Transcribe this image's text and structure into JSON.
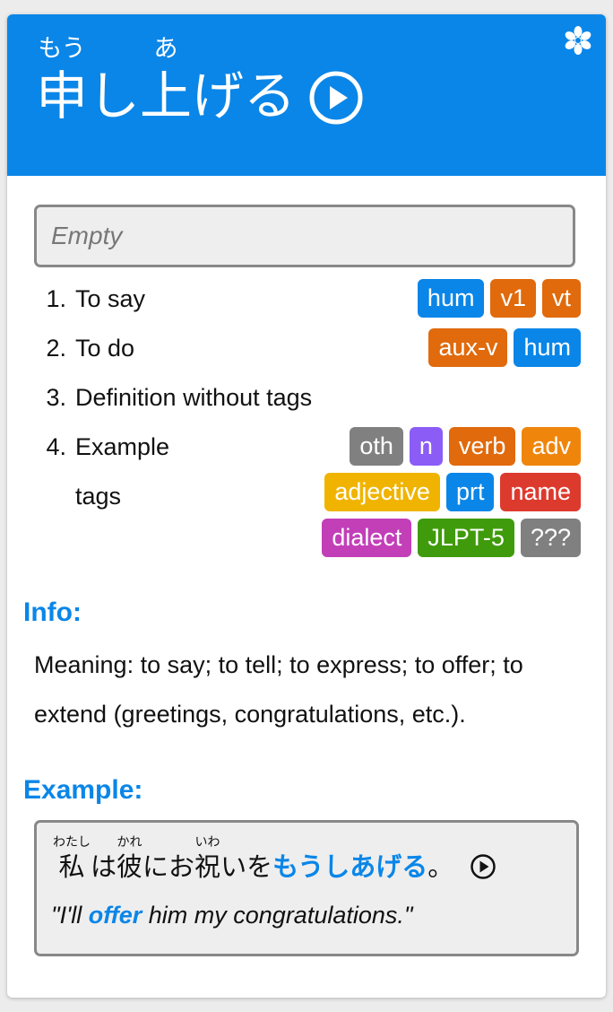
{
  "header": {
    "word": [
      {
        "kanji": "申",
        "furigana": "もう"
      },
      {
        "kanji": "し",
        "furigana": ""
      },
      {
        "kanji": "上",
        "furigana": "あ"
      },
      {
        "kanji": "げる",
        "furigana": ""
      }
    ],
    "bg_color": "#0a86e8",
    "settings_icon": "gear-icon",
    "play_icon": "play-circle-icon"
  },
  "notes": {
    "placeholder": "Empty"
  },
  "definitions": [
    {
      "num": "1.",
      "text": "To say",
      "tags": [
        {
          "label": "hum",
          "color": "#0a86e8"
        },
        {
          "label": "v1",
          "color": "#e06a0c"
        },
        {
          "label": "vt",
          "color": "#e06a0c"
        }
      ]
    },
    {
      "num": "2.",
      "text": "To do",
      "tags": [
        {
          "label": "aux-v",
          "color": "#e06a0c"
        },
        {
          "label": "hum",
          "color": "#0a86e8"
        }
      ]
    },
    {
      "num": "3.",
      "text": "Definition without tags",
      "tags": []
    },
    {
      "num": "4.",
      "text": "Example tags",
      "tags": [
        {
          "label": "oth",
          "color": "#808080"
        },
        {
          "label": "n",
          "color": "#8b5cf6"
        },
        {
          "label": "verb",
          "color": "#e06a0c"
        },
        {
          "label": "adv",
          "color": "#f0850c"
        },
        {
          "label": "adjective",
          "color": "#f0b400"
        },
        {
          "label": "prt",
          "color": "#0a86e8"
        },
        {
          "label": "name",
          "color": "#dd3a2e"
        },
        {
          "label": "dialect",
          "color": "#c23fb8"
        },
        {
          "label": "JLPT-5",
          "color": "#3f9b0b"
        },
        {
          "label": "???",
          "color": "#808080"
        }
      ]
    }
  ],
  "info": {
    "heading": "Info:",
    "text": "Meaning: to say; to tell; to express; to offer; to extend (greetings, congratulations, etc.)."
  },
  "example": {
    "heading": "Example:",
    "sentence": [
      {
        "text": "私",
        "furigana": "わたし",
        "highlight": false
      },
      {
        "text": "は",
        "furigana": "",
        "highlight": false
      },
      {
        "text": "彼",
        "furigana": "かれ",
        "highlight": false
      },
      {
        "text": "にお",
        "furigana": "",
        "highlight": false
      },
      {
        "text": "祝",
        "furigana": "いわ",
        "highlight": false
      },
      {
        "text": "いを",
        "furigana": "",
        "highlight": false
      },
      {
        "text": "もうしあげる",
        "furigana": "",
        "highlight": true
      },
      {
        "text": "。",
        "furigana": "",
        "highlight": false
      }
    ],
    "translation_before": "\"I'll ",
    "translation_highlight": "offer",
    "translation_after": " him my congratulations.\""
  }
}
